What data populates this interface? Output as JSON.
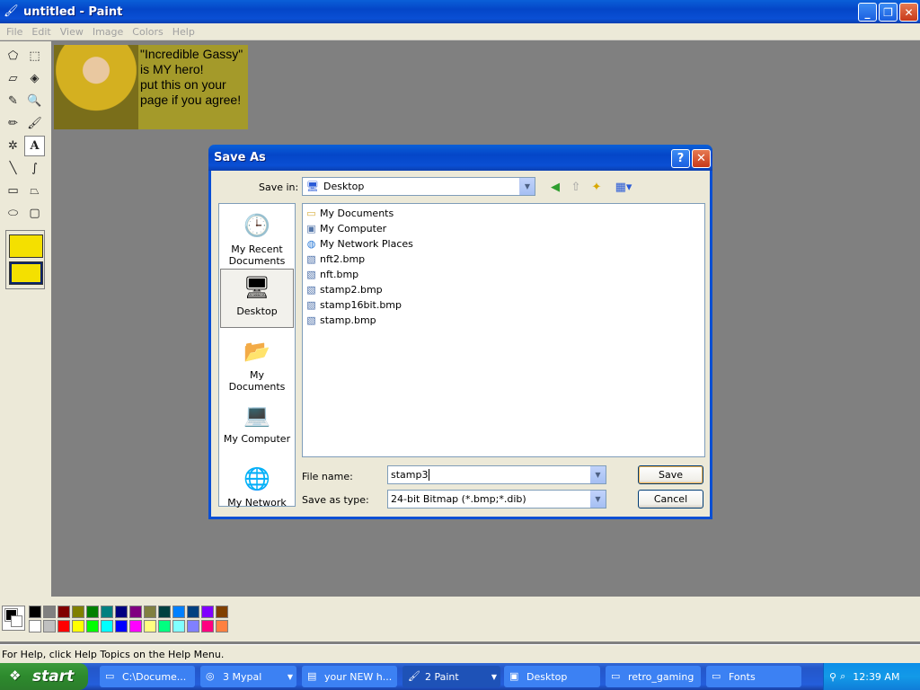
{
  "window": {
    "title": "untitled - Paint",
    "menu": [
      "File",
      "Edit",
      "View",
      "Image",
      "Colors",
      "Help"
    ]
  },
  "canvas_image": {
    "text": [
      "\"Incredible Gassy\"",
      "is MY hero!",
      "put this on your",
      "page if you agree!"
    ]
  },
  "status_bar": {
    "text": "For Help, click Help Topics on the Help Menu."
  },
  "palette": {
    "top": [
      "#000000",
      "#808080",
      "#800000",
      "#808000",
      "#008000",
      "#008080",
      "#000080",
      "#800080",
      "#808040",
      "#004040",
      "#0080ff",
      "#004080",
      "#8000ff",
      "#804000"
    ],
    "bottom": [
      "#ffffff",
      "#c0c0c0",
      "#ff0000",
      "#ffff00",
      "#00ff00",
      "#00ffff",
      "#0000ff",
      "#ff00ff",
      "#ffff80",
      "#00ff80",
      "#80ffff",
      "#8080ff",
      "#ff0080",
      "#ff8040"
    ]
  },
  "dialog": {
    "title": "Save As",
    "help_label": "?",
    "close_label": "✕",
    "save_in_label": "Save in:",
    "save_in_value": "Desktop",
    "places": [
      {
        "label": "My Recent Documents",
        "icon": "recent-documents-icon"
      },
      {
        "label": "Desktop",
        "icon": "desktop-icon"
      },
      {
        "label": "My Documents",
        "icon": "my-documents-icon"
      },
      {
        "label": "My Computer",
        "icon": "my-computer-icon"
      },
      {
        "label": "My Network",
        "icon": "my-network-icon"
      }
    ],
    "files": [
      {
        "name": "My Documents",
        "icon": "folder-icon"
      },
      {
        "name": "My Computer",
        "icon": "computer-icon"
      },
      {
        "name": "My Network Places",
        "icon": "network-icon"
      },
      {
        "name": "nft2.bmp",
        "icon": "bitmap-file-icon"
      },
      {
        "name": "nft.bmp",
        "icon": "bitmap-file-icon"
      },
      {
        "name": "stamp2.bmp",
        "icon": "bitmap-file-icon"
      },
      {
        "name": "stamp16bit.bmp",
        "icon": "bitmap-file-icon"
      },
      {
        "name": "stamp.bmp",
        "icon": "bitmap-file-icon"
      }
    ],
    "file_name_label": "File name:",
    "file_name_value": "stamp3",
    "save_type_label": "Save as type:",
    "save_type_value": "24-bit Bitmap (*.bmp;*.dib)",
    "save_button": "Save",
    "cancel_button": "Cancel"
  },
  "taskbar": {
    "start_label": "start",
    "tasks": [
      {
        "label": "C:\\Docume...",
        "icon": "folder-icon"
      },
      {
        "label": "3 Mypal",
        "icon": "browser-icon"
      },
      {
        "label": "your NEW h...",
        "icon": "document-icon"
      },
      {
        "label": "2 Paint",
        "icon": "paint-icon",
        "active": true
      },
      {
        "label": "Desktop",
        "icon": "desktop-icon"
      },
      {
        "label": "retro_gaming",
        "icon": "folder-icon"
      },
      {
        "label": "Fonts",
        "icon": "folder-icon"
      }
    ],
    "clock": "12:39 AM"
  }
}
